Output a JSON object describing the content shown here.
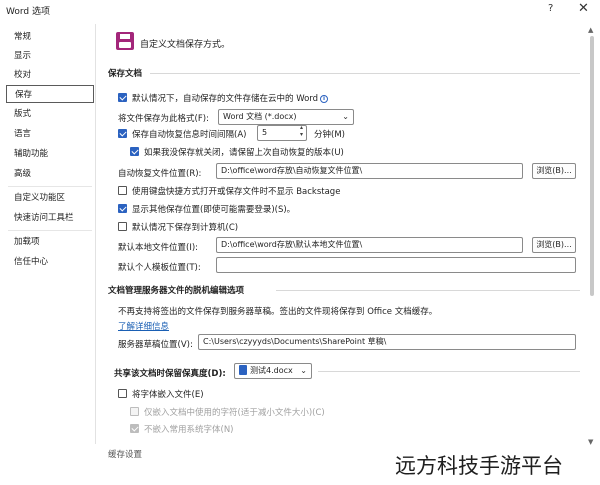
{
  "window": {
    "title": "Word 选项",
    "help": "?",
    "close": "✕"
  },
  "sidebar": {
    "items": [
      {
        "label": "常规"
      },
      {
        "label": "显示"
      },
      {
        "label": "校对"
      },
      {
        "label": "保存"
      },
      {
        "label": "版式"
      },
      {
        "label": "语言"
      },
      {
        "label": "辅助功能"
      },
      {
        "label": "高级"
      },
      {
        "label": "自定义功能区"
      },
      {
        "label": "快速访问工具栏"
      },
      {
        "label": "加载项"
      },
      {
        "label": "信任中心"
      }
    ]
  },
  "header": {
    "title": "自定义文档保存方式。"
  },
  "save_docs": {
    "heading": "保存文档",
    "cloud_default": {
      "label": "默认情况下，自动保存的文件存储在云中的 Word",
      "checked": true
    },
    "format_label": "将文件保存为此格式(F):",
    "format_value": "Word 文档 (*.docx)",
    "autorecover": {
      "label": "保存自动恢复信息时间间隔(A)",
      "checked": true,
      "minutes": "5",
      "unit": "分钟(M)"
    },
    "keep_last": {
      "label": "如果我没保存就关闭，请保留上次自动恢复的版本(U)",
      "checked": true
    },
    "autorecover_location_label": "自动恢复文件位置(R):",
    "autorecover_location_value": "D:\\office\\word存放\\自动恢复文件位置\\",
    "browse_label": "浏览(B)...",
    "no_backstage": {
      "label": "使用键盘快捷方式打开或保存文件时不显示 Backstage",
      "checked": false
    },
    "show_other": {
      "label": "显示其他保存位置(即使可能需要登录)(S)。",
      "checked": true
    },
    "default_local": {
      "label": "默认情况下保存到计算机(C)",
      "checked": false
    },
    "default_local_label": "默认本地文件位置(I):",
    "default_local_value": "D:\\office\\word存放\\默认本地文件位置\\",
    "personal_templates_label": "默认个人模板位置(T):",
    "personal_templates_value": ""
  },
  "offline": {
    "heading": "文档管理服务器文件的脱机编辑选项",
    "description": "不再支持将签出的文件保存到服务器草稿。签出的文件现将保存到 Office 文档缓存。",
    "learn_more": "了解详细信息",
    "drafts_label": "服务器草稿位置(V):",
    "drafts_value": "C:\\Users\\czyyyds\\Documents\\SharePoint 草稿\\"
  },
  "fidelity": {
    "heading": "共享该文档时保留保真度(D):",
    "document": "测试4.docx",
    "embed_fonts": {
      "label": "将字体嵌入文件(E)",
      "checked": false
    },
    "embed_used_only": {
      "label": "仅嵌入文档中使用的字符(适于减小文件大小)(C)",
      "checked": false
    },
    "no_common_fonts": {
      "label": "不嵌入常用系统字体(N)",
      "checked": true
    }
  },
  "cache": {
    "heading": "缓存设置"
  },
  "watermark": "远方科技手游平台"
}
